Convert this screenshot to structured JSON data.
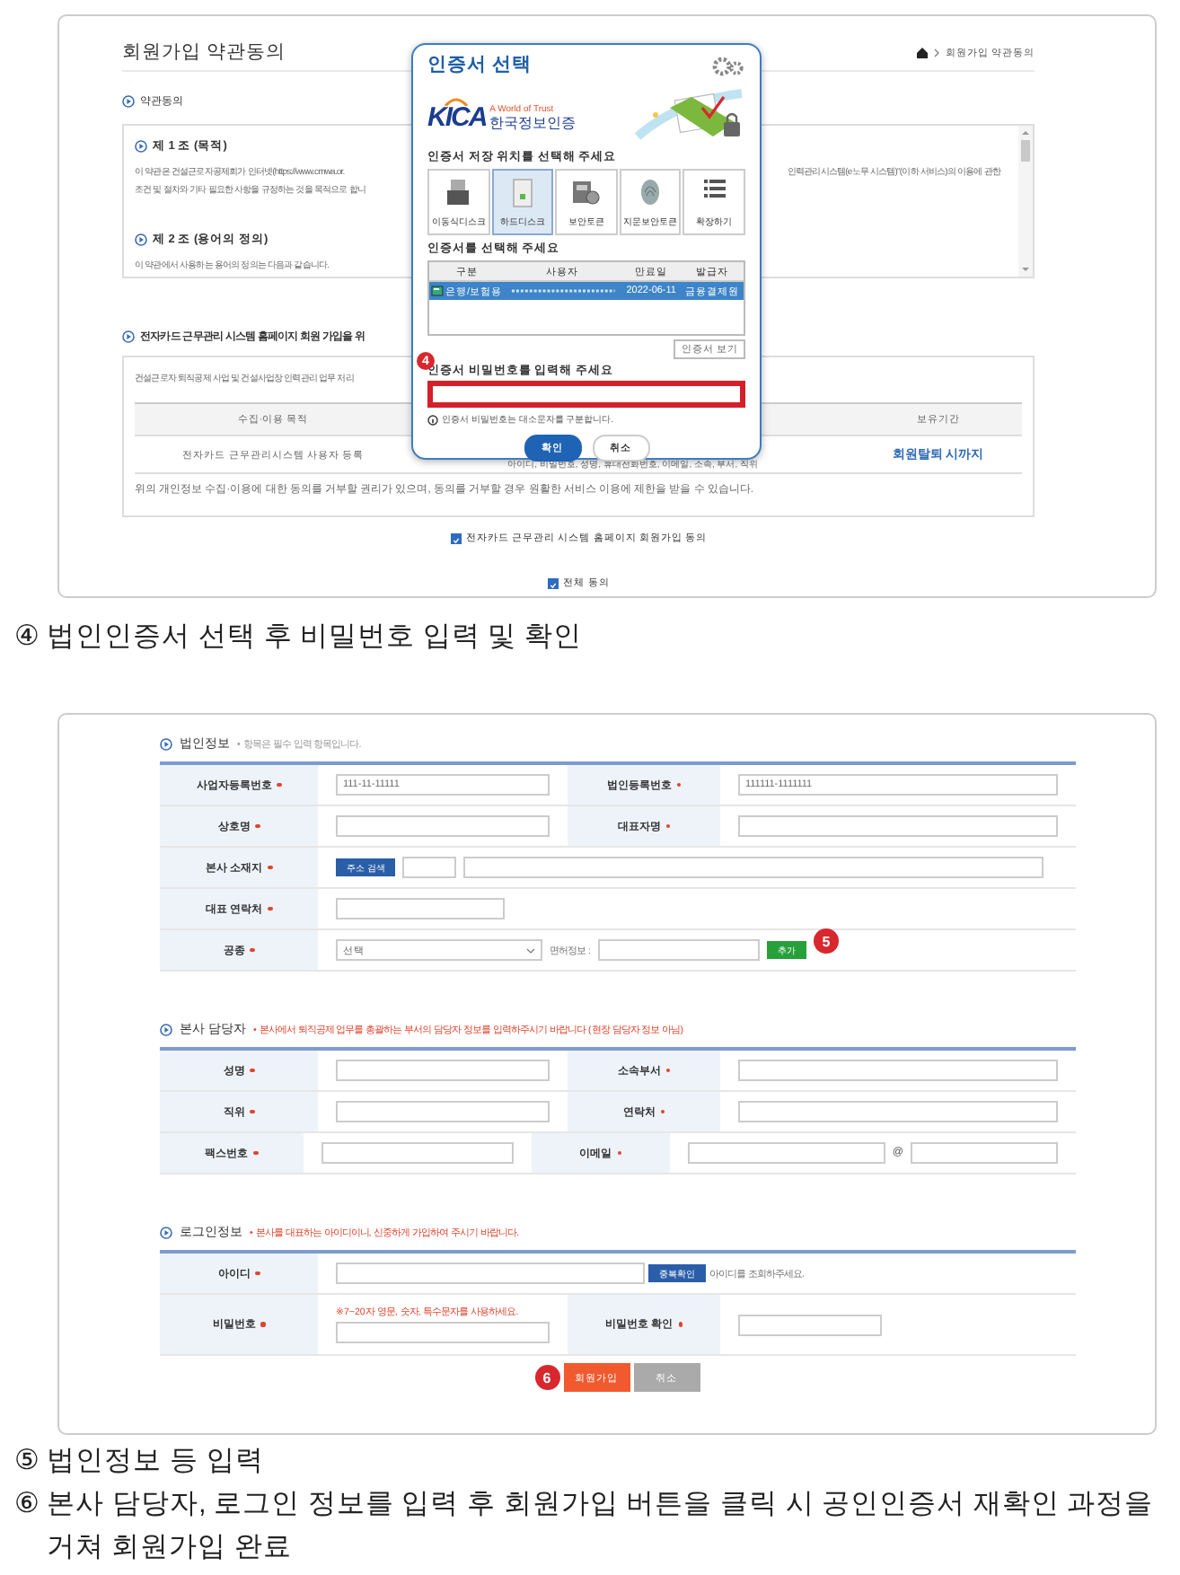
{
  "signup_terms_screen": {
    "page_title": "회원가입 약관동의",
    "breadcrumb": "회원가입 약관동의",
    "terms_heading": "약관동의",
    "articles": [
      {
        "title": "제 1 조 (목적)",
        "lines": [
          "이 약관은 건설근로자공제회가 인터넷(https://www.cmwa.or.",
          "조건 및 절차와 기타 필요한 사항을 규정하는 것을 목적으로 합니"
        ],
        "line_right": "인력관리시스템(e노무 시스템)\"(이하 서비스)의 이용에 관한"
      },
      {
        "title": "제 2 조 (용어의 정의)",
        "lines": [
          "이 약관에서 사용하는 용어의 정의는 다음과 같습니다."
        ]
      }
    ],
    "privacy_heading": "전자카드 근무관리 시스템 홈페이지 회원 가입을 위",
    "privacy_intro": "건설근로자 퇴직공제 사업 및 건설사업장 인력관리 업무 처리",
    "privacy_columns": [
      "수집·이용 목적",
      "보유기간"
    ],
    "privacy_row": [
      "전자카드 근무관리시스템 사용자 등록",
      "아이디, 비밀번호, 성명, 휴대전화번호, 이메일, 소속, 부서, 직위",
      "회원탈퇴 시까지"
    ],
    "privacy_note": "위의 개인정보 수집·이용에 대한 동의를 거부할 권리가 있으며, 동의를 거부할 경우 원활한 서비스 이용에 제한을 받을 수 있습니다.",
    "agreements": [
      {
        "label": "전자카드 근무관리 시스템 홈페이지 회원가입 동의",
        "checked": true
      },
      {
        "label": "전체 동의",
        "checked": true
      }
    ]
  },
  "certificate_dialog": {
    "title": "인증서 선택",
    "logo_brand": "KICA",
    "logo_slogan": "A World of Trust",
    "logo_name": "한국정보인증",
    "location_label": "인증서 저장 위치를 선택해 주세요",
    "locations": [
      {
        "label": "이동식디스크",
        "kind": "usb",
        "selected": false
      },
      {
        "label": "하드디스크",
        "kind": "disk",
        "selected": true
      },
      {
        "label": "보안토큰",
        "kind": "token",
        "selected": false
      },
      {
        "label": "지문보안토큰",
        "kind": "fingerprint",
        "selected": false
      },
      {
        "label": "확장하기",
        "kind": "list",
        "selected": false
      }
    ],
    "certificate_label": "인증서를 선택해 주세요",
    "certificate_columns": [
      "구분",
      "사용자",
      "만료일",
      "발급자"
    ],
    "certificates": [
      {
        "type": "은행/보험용",
        "expiry": "2022-06-11",
        "issuer": "금융결제원",
        "selected": true
      }
    ],
    "view_button": "인증서 보기",
    "step_badge": "4",
    "password_label": "인증서 비밀번호를 입력해 주세요",
    "password_hint": "인증서 비밀번호는 대소문자를 구분합니다.",
    "buttons": [
      {
        "label": "확인",
        "kind": "primary"
      },
      {
        "label": "취소",
        "kind": "secondary"
      }
    ]
  },
  "captions_top": [
    "④ 법인인증서 선택 후 비밀번호 입력 및 확인"
  ],
  "corporate_form": {
    "sections": [
      {
        "title": "법인정보",
        "note": "• 항목은 필수 입력 항목입니다.",
        "kind": "muted",
        "rows": [
          {
            "kind": "pair",
            "fields": [
              {
                "label": "사업자등록번호",
                "required": true,
                "value": "111-11-11111"
              },
              {
                "label": "법인등록번호",
                "required": true,
                "value": "111111-1111111"
              }
            ]
          },
          {
            "kind": "pair",
            "fields": [
              {
                "label": "상호명",
                "required": true
              },
              {
                "label": "대표자명",
                "required": true
              }
            ]
          },
          {
            "kind": "address",
            "label": "본사 소재지",
            "required": true,
            "button": "주소 검색"
          },
          {
            "kind": "single",
            "label": "대표 연락처",
            "required": true
          },
          {
            "kind": "trade",
            "label": "공종",
            "required": true,
            "select": "선택",
            "extra_label": "면허정보 :",
            "button": "추가",
            "badge": "5"
          }
        ]
      },
      {
        "title": "본사 담당자",
        "note": "• 본사에서 퇴직공제 업무를 총괄하는 부서의 담당자 정보를 입력하주시기 바랍니다 (현장 담당자 정보 아님)",
        "kind": "alert",
        "rows": [
          {
            "kind": "pair",
            "fields": [
              {
                "label": "성명",
                "required": true
              },
              {
                "label": "소속부서",
                "required": true
              }
            ]
          },
          {
            "kind": "pair",
            "fields": [
              {
                "label": "직위",
                "required": true
              },
              {
                "label": "연락처",
                "required": true
              }
            ]
          },
          {
            "kind": "pair",
            "fields": [
              {
                "label": "팩스번호",
                "required": true
              },
              {
                "label": "이메일",
                "required": true,
                "separator": "@"
              }
            ]
          }
        ]
      },
      {
        "title": "로그인정보",
        "note": "• 본사를 대표하는 아이디이니, 신중하게 가입하여 주시기 바랍니다.",
        "kind": "alert",
        "rows": [
          {
            "kind": "id",
            "label": "아이디",
            "required": true,
            "button": "중복확인",
            "message": "아이디를 조회하주세요."
          },
          {
            "kind": "password",
            "fields": [
              {
                "label": "비밀번호",
                "required": true,
                "hint": "※7~20자 영문, 숫자, 특수문자를 사용하세요."
              },
              {
                "label": "비밀번호 확인",
                "required": true
              }
            ]
          }
        ]
      }
    ],
    "badge": "6",
    "buttons": [
      {
        "label": "회원가입",
        "kind": "primary"
      },
      {
        "label": "취소",
        "kind": "secondary"
      }
    ]
  },
  "captions_bottom": [
    "⑤ 법인정보 등 입력",
    "⑥ 본사 담당자, 로그인 정보를 입력 후 회원가입 버튼을 클릭 시 공인인증서 재확인 과정을 거쳐 회원가입 완료"
  ]
}
